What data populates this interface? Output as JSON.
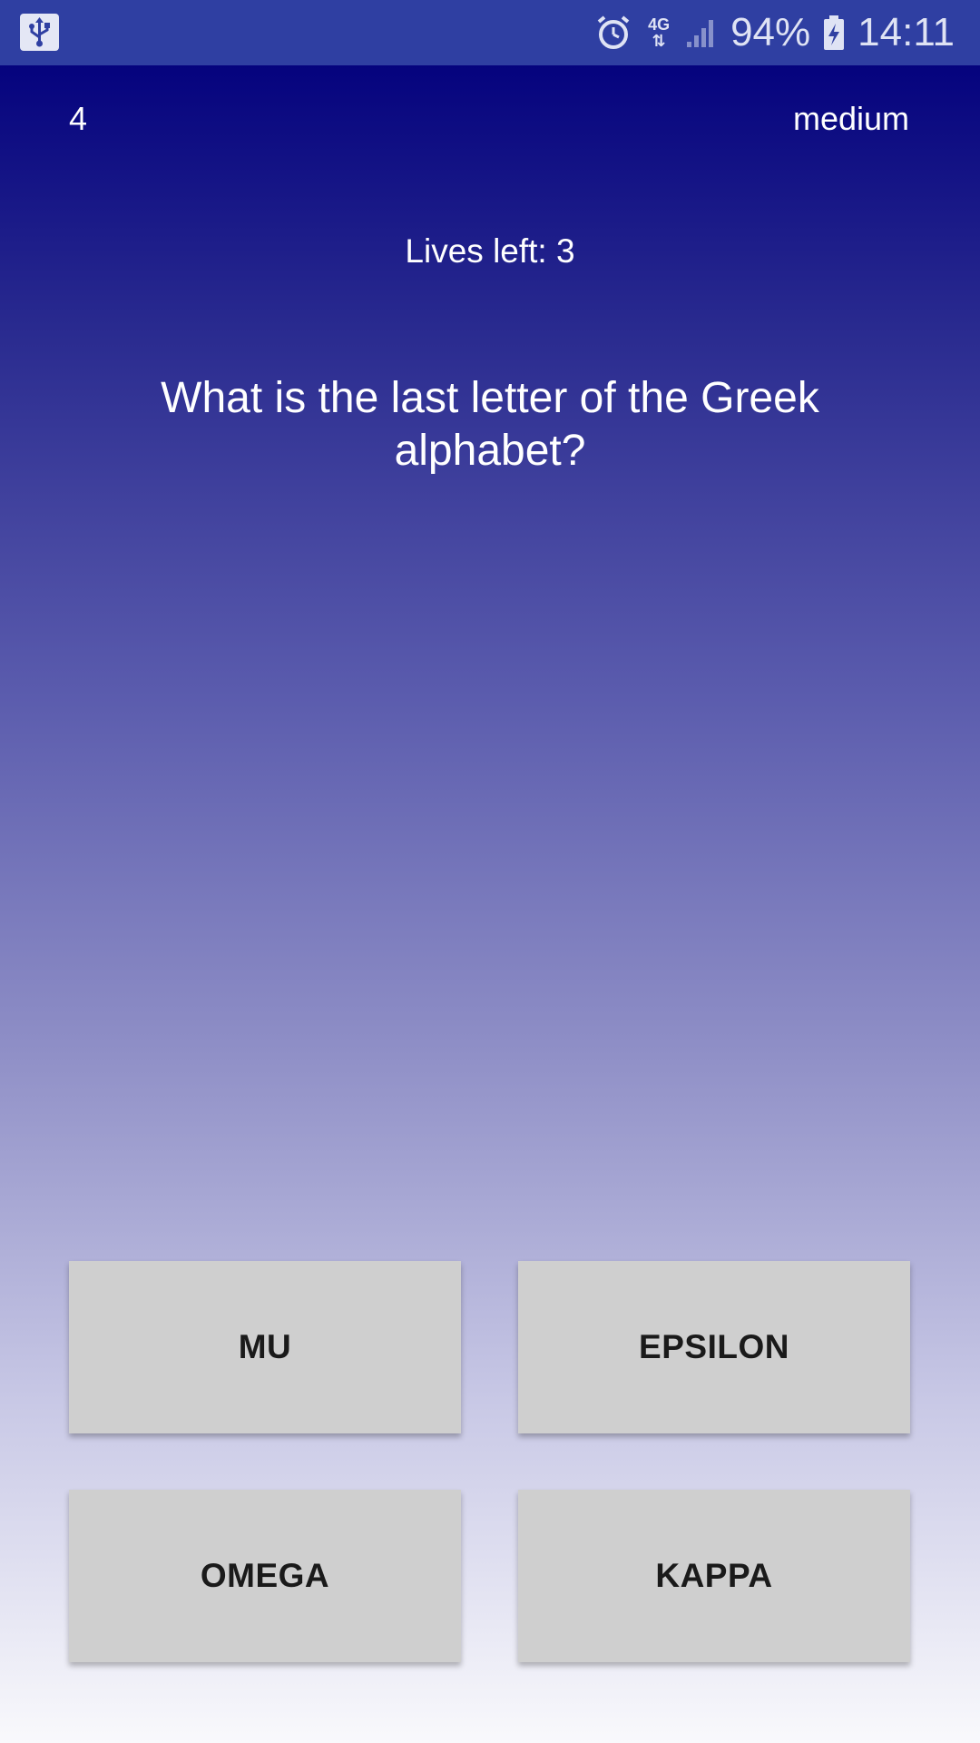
{
  "status_bar": {
    "icons": [
      "usb-icon",
      "alarm-icon",
      "network-4g-icon",
      "signal-icon",
      "battery-charging-icon"
    ],
    "network_label": "4G",
    "battery": "94%",
    "time": "14:11"
  },
  "game": {
    "level": "4",
    "difficulty": "medium",
    "lives": "Lives left: 3",
    "question": "What is the last letter of the Greek alphabet?"
  },
  "answers": [
    {
      "label": "MU"
    },
    {
      "label": "EPSILON"
    },
    {
      "label": "OMEGA"
    },
    {
      "label": "KAPPA"
    }
  ],
  "colors": {
    "status_bar": "#2f3fa2",
    "gradient_top": "#05037e",
    "gradient_bottom": "#f9f9fc",
    "button_bg": "#cfcfcf",
    "button_text": "#1a1a1a"
  }
}
